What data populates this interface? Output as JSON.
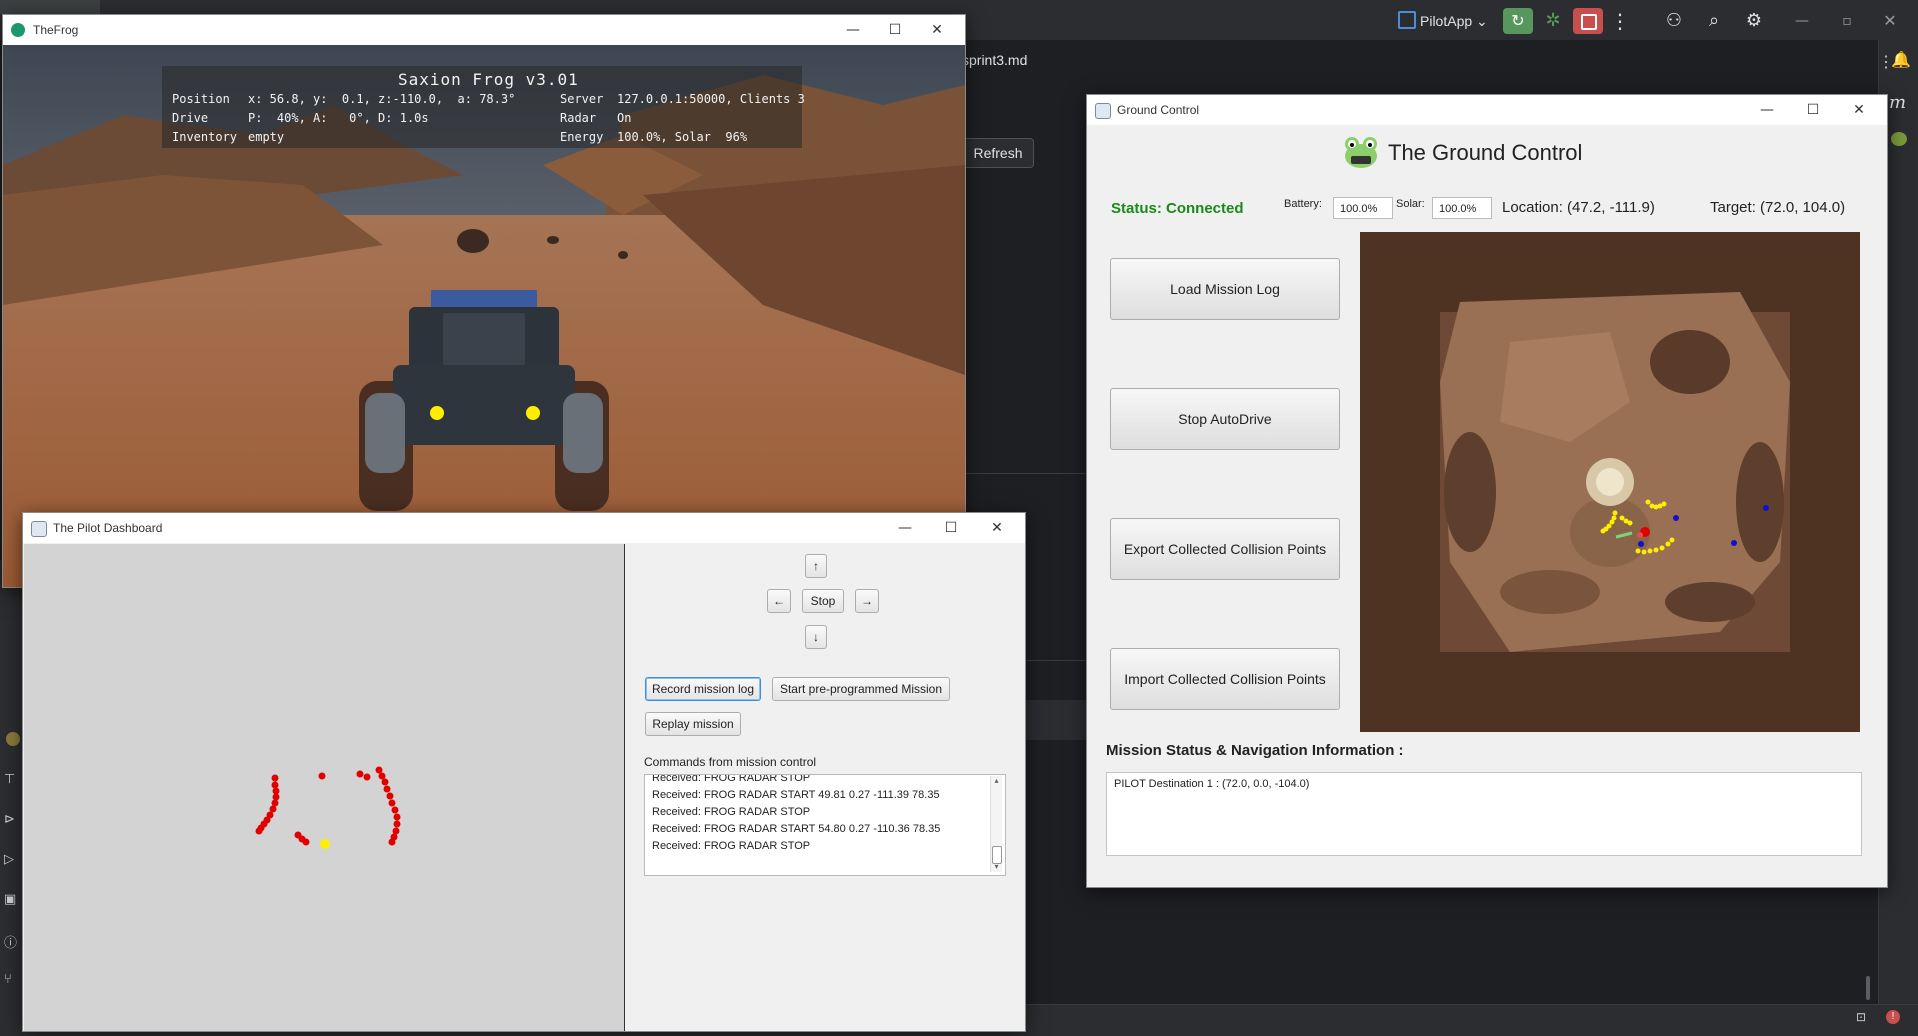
{
  "ide": {
    "run_config": "PilotApp",
    "tab_file": "sprint3.md",
    "refresh_label": "Refresh"
  },
  "frog_window": {
    "title": "TheFrog",
    "hud": {
      "title": "Saxion Frog v3.01",
      "position_label": "Position",
      "position_value": "x: 56.8, y:  0.1, z:-110.0,  a: 78.3°",
      "drive_label": "Drive",
      "drive_value": "P:  40%, A:   0°, D: 1.0s",
      "inventory_label": "Inventory",
      "inventory_value": "empty",
      "server_label": "Server",
      "server_value": "127.0.0.1:50000, Clients 3",
      "radar_label": "Radar",
      "radar_value": "On",
      "energy_label": "Energy",
      "energy_value": "100.0%, Solar  96%"
    }
  },
  "pilot_window": {
    "title": "The Pilot Dashboard",
    "controls": {
      "up": "↑",
      "left": "←",
      "stop": "Stop",
      "right": "→",
      "down": "↓"
    },
    "buttons": {
      "record": "Record mission log",
      "start_mission": "Start pre-programmed Mission",
      "replay": "Replay mission"
    },
    "commands_label": "Commands from mission control",
    "log": [
      "Received: FROG RADAR STOP",
      "Received: FROG RADAR START 49.81 0.27 -111.39 78.35",
      "Received: FROG RADAR STOP",
      "Received: FROG RADAR START 54.80 0.27 -110.36 78.35",
      "Received: FROG RADAR STOP"
    ]
  },
  "ground_control": {
    "window_title": "Ground Control",
    "title": "The Ground Control",
    "status": "Status: Connected",
    "battery_label": "Battery:",
    "battery_value": "100.0%",
    "solar_label": "Solar:",
    "solar_value": "100.0%",
    "location": "Location: (47.2, -111.9)",
    "target": "Target: (72.0, 104.0)",
    "buttons": {
      "load_log": "Load Mission Log",
      "stop_autodrive": "Stop AutoDrive",
      "export_points": "Export Collected Collision Points",
      "import_points": "Import Collected Collision Points"
    },
    "nav_heading": "Mission Status & Navigation Information :",
    "nav_text": "PILOT Destination 1 : (72.0, 0.0, -104.0)"
  },
  "colors": {
    "status_green": "#1a8a1a",
    "radar_point": "#e00000",
    "frog_marker": "#ffff00",
    "path_yellow": "#ffee00",
    "waypoint_blue": "#1010d0"
  }
}
